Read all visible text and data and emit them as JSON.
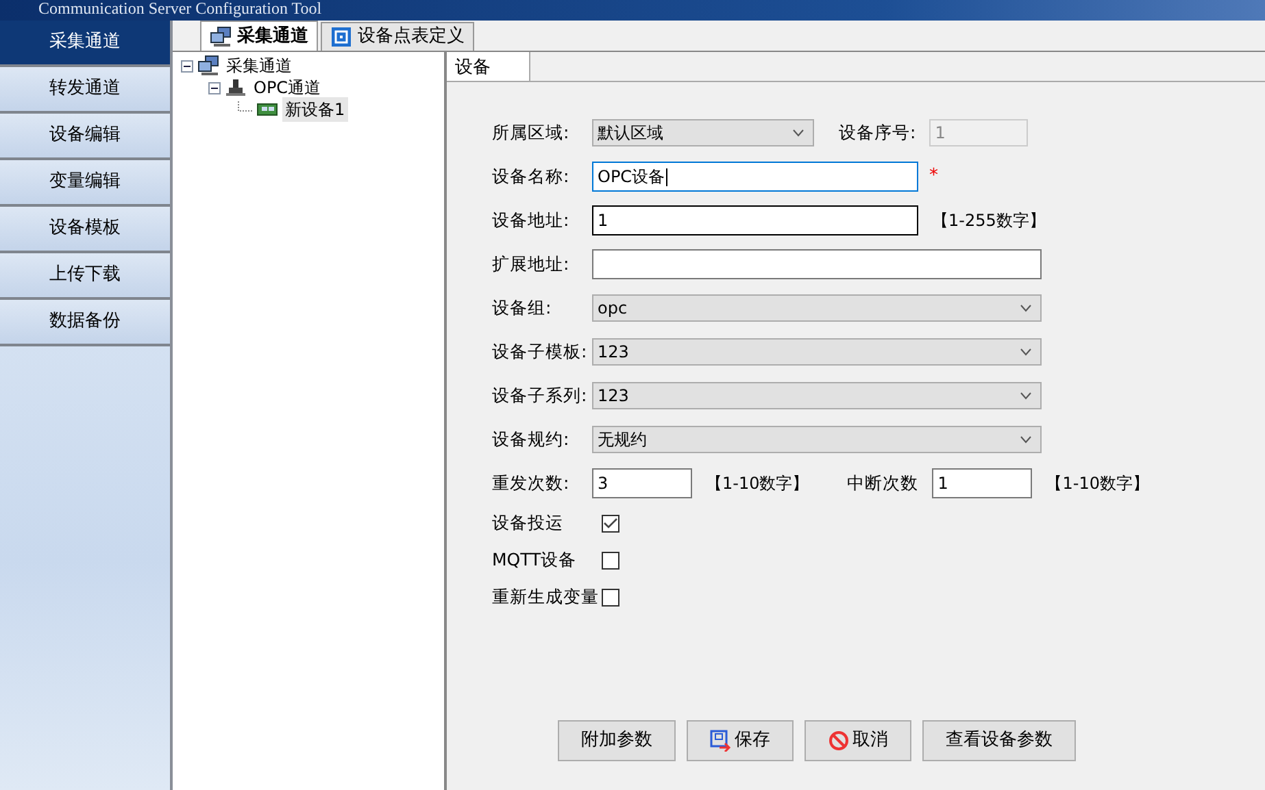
{
  "window": {
    "title": "Communication Server Configuration Tool"
  },
  "sidebar": {
    "items": [
      {
        "label": "采集通道",
        "selected": true
      },
      {
        "label": "转发通道",
        "selected": false
      },
      {
        "label": "设备编辑",
        "selected": false
      },
      {
        "label": "变量编辑",
        "selected": false
      },
      {
        "label": "设备模板",
        "selected": false
      },
      {
        "label": "上传下载",
        "selected": false
      },
      {
        "label": "数据备份",
        "selected": false
      }
    ]
  },
  "tabs": [
    {
      "label": "采集通道",
      "selected": true
    },
    {
      "label": "设备点表定义",
      "selected": false
    }
  ],
  "tree": [
    {
      "label": "采集通道",
      "kind": "group",
      "expanded": true,
      "selected": false,
      "children": [
        {
          "label": "OPC通道",
          "kind": "channel",
          "expanded": true,
          "selected": false,
          "children": [
            {
              "label": "新设备1",
              "kind": "device",
              "selected": true
            }
          ]
        }
      ]
    }
  ],
  "panel_tab": {
    "label": "设备"
  },
  "form": [
    [
      {
        "kind": "label",
        "text": "所属区域:"
      },
      {
        "kind": "select",
        "value": "默认区域"
      },
      {
        "kind": "label",
        "text": "设备序号:"
      },
      {
        "kind": "input",
        "value": "1",
        "disabled": true,
        "focused": false
      }
    ],
    [
      {
        "kind": "label",
        "text": "设备名称:"
      },
      {
        "kind": "input",
        "value": "OPC设备",
        "disabled": false,
        "focused": true
      },
      {
        "kind": "required",
        "text": "*"
      }
    ],
    [
      {
        "kind": "label",
        "text": "设备地址:"
      },
      {
        "kind": "input",
        "value": "1",
        "disabled": false,
        "focused": false
      },
      {
        "kind": "hint",
        "text": "【1-255数字】"
      }
    ],
    [
      {
        "kind": "label",
        "text": "扩展地址:"
      },
      {
        "kind": "input",
        "disabled": false,
        "focused": false
      }
    ],
    [
      {
        "kind": "label",
        "text": "设备组:"
      },
      {
        "kind": "select",
        "value": "opc"
      }
    ],
    [
      {
        "kind": "label",
        "text": "设备子模板:"
      },
      {
        "kind": "select",
        "value": "123"
      }
    ],
    [
      {
        "kind": "label",
        "text": "设备子系列:"
      },
      {
        "kind": "select",
        "value": "123"
      }
    ],
    [
      {
        "kind": "label",
        "text": "设备规约:"
      },
      {
        "kind": "select",
        "value": "无规约"
      }
    ],
    [
      {
        "kind": "label",
        "text": "重发次数:"
      },
      {
        "kind": "input",
        "value": "3",
        "disabled": false,
        "focused": false
      },
      {
        "kind": "hint",
        "text": "【1-10数字】"
      },
      {
        "kind": "label",
        "text": "中断次数"
      },
      {
        "kind": "input",
        "value": "1",
        "disabled": false,
        "focused": false
      },
      {
        "kind": "hint",
        "text": "【1-10数字】"
      }
    ]
  ],
  "checkboxes": [
    {
      "label": "设备投运",
      "checked": true
    },
    {
      "label": "MQTT设备",
      "checked": false
    },
    {
      "label": "重新生成变量",
      "checked": false
    }
  ],
  "buttons": [
    {
      "label": "附加参数"
    },
    {
      "label": "保存"
    },
    {
      "label": "取消"
    },
    {
      "label": "查看设备参数"
    }
  ]
}
